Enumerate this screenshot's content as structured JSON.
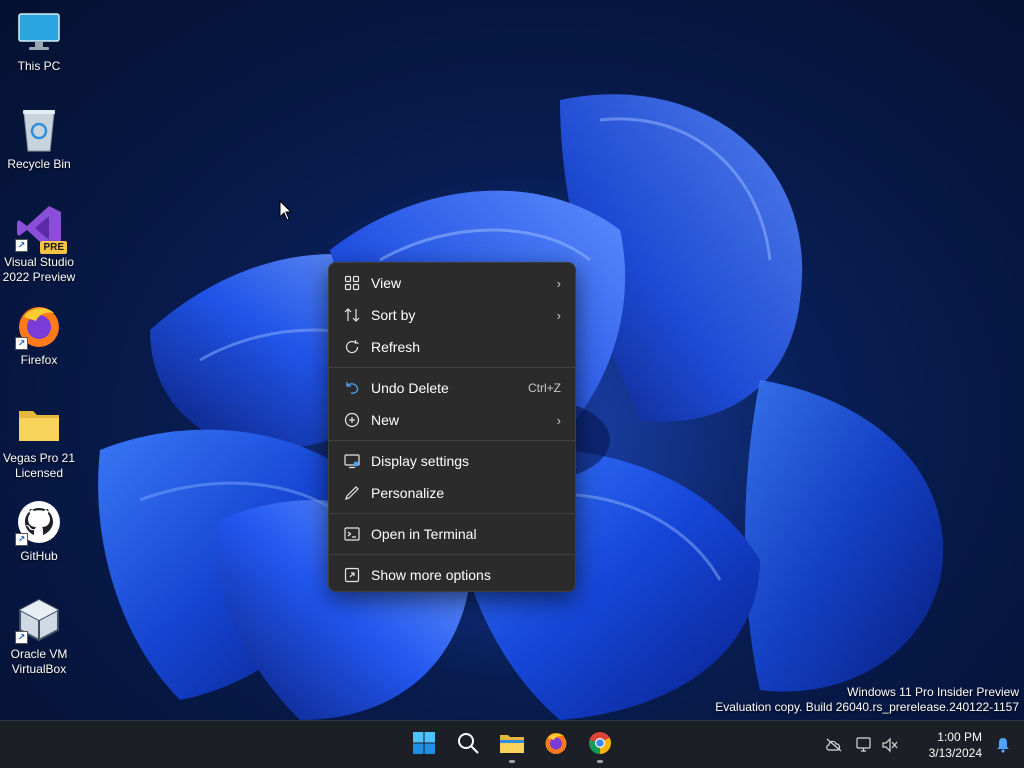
{
  "desktop_icons": [
    {
      "label": "This PC",
      "icon": "monitor-icon"
    },
    {
      "label": "Recycle Bin",
      "icon": "recycle-bin-icon"
    },
    {
      "label": "Visual Studio\n2022 Preview",
      "icon": "visual-studio-icon",
      "badge": "PRE"
    },
    {
      "label": "Firefox",
      "icon": "firefox-icon"
    },
    {
      "label": "Vegas Pro 21\nLicensed",
      "icon": "folder-icon"
    },
    {
      "label": "GitHub",
      "icon": "github-icon"
    },
    {
      "label": "Oracle VM\nVirtualBox",
      "icon": "virtualbox-icon"
    }
  ],
  "context_menu": {
    "items": [
      {
        "label": "View",
        "icon": "grid-icon",
        "submenu": true
      },
      {
        "label": "Sort by",
        "icon": "sort-icon",
        "submenu": true
      },
      {
        "label": "Refresh",
        "icon": "refresh-icon"
      },
      {
        "label": "Undo Delete",
        "icon": "undo-icon",
        "shortcut": "Ctrl+Z"
      },
      {
        "label": "New",
        "icon": "plus-circle-icon",
        "submenu": true
      },
      {
        "label": "Display settings",
        "icon": "display-settings-icon"
      },
      {
        "label": "Personalize",
        "icon": "pen-icon"
      },
      {
        "label": "Open in Terminal",
        "icon": "terminal-icon"
      },
      {
        "label": "Show more options",
        "icon": "more-options-icon"
      }
    ],
    "arrow": "›"
  },
  "watermark": {
    "line1": "Windows 11 Pro Insider Preview",
    "line2": "Evaluation copy. Build 26040.rs_prerelease.240122-1157"
  },
  "taskbar": {
    "apps": [
      "start-icon",
      "search-icon",
      "file-explorer-icon",
      "firefox-icon",
      "chrome-icon"
    ],
    "clock": {
      "time": "1:00 PM",
      "date": "3/13/2024"
    },
    "tray": [
      "cloud-offline-icon",
      "network-icon",
      "volume-muted-icon",
      "notification-bell-icon"
    ]
  },
  "colors": {
    "menu_bg": "#2b2b2b",
    "taskbar_bg": "#1c1f26",
    "accent": "#1f6fd6"
  }
}
